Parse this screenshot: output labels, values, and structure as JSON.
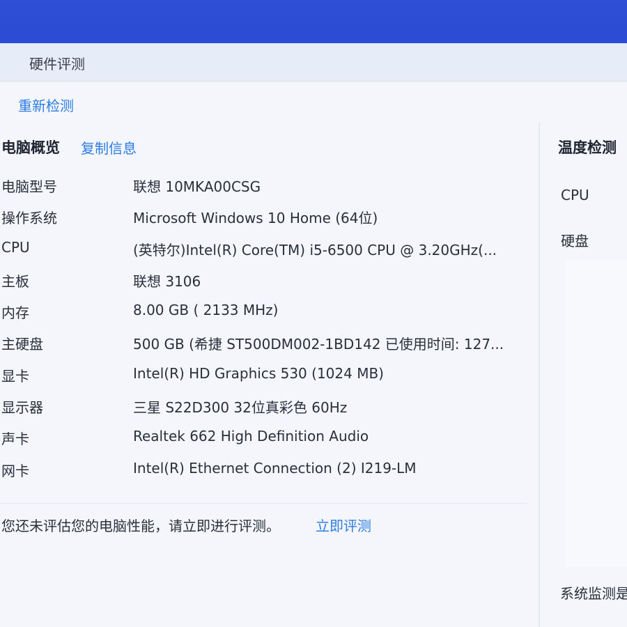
{
  "tab": {
    "label": "硬件评测"
  },
  "actions": {
    "recheck_label": "重新检测"
  },
  "overview": {
    "title": "电脑概览",
    "copy_label": "复制信息",
    "rows": [
      {
        "key": "电脑型号",
        "value": "联想 10MKA00CSG"
      },
      {
        "key": "操作系统",
        "value": "Microsoft Windows 10 Home (64位)"
      },
      {
        "key": "CPU",
        "value": "(英特尔)Intel(R) Core(TM) i5-6500 CPU @ 3.20GHz(..."
      },
      {
        "key": "主板",
        "value": "联想 3106"
      },
      {
        "key": "内存",
        "value": "8.00 GB (   2133 MHz)"
      },
      {
        "key": "主硬盘",
        "value": "500 GB (希捷 ST500DM002-1BD142 已使用时间: 127..."
      },
      {
        "key": "显卡",
        "value": "Intel(R) HD Graphics 530 (1024 MB)"
      },
      {
        "key": "显示器",
        "value": "三星 S22D300 32位真彩色 60Hz"
      },
      {
        "key": "声卡",
        "value": "Realtek 662 High Definition Audio"
      },
      {
        "key": "网卡",
        "value": "Intel(R) Ethernet Connection (2) I219-LM"
      }
    ],
    "notice_text": "您还未评估您的电脑性能，请立即进行评测。",
    "notice_link": "立即评测"
  },
  "temperature": {
    "title": "温度检测",
    "items": [
      "CPU",
      "硬盘"
    ],
    "footer": "系统监测是"
  },
  "colors": {
    "topbar": "#2b4bd3",
    "link": "#2d7ce6",
    "background": "#f4f6fc",
    "tabbar": "#e6edf8"
  }
}
